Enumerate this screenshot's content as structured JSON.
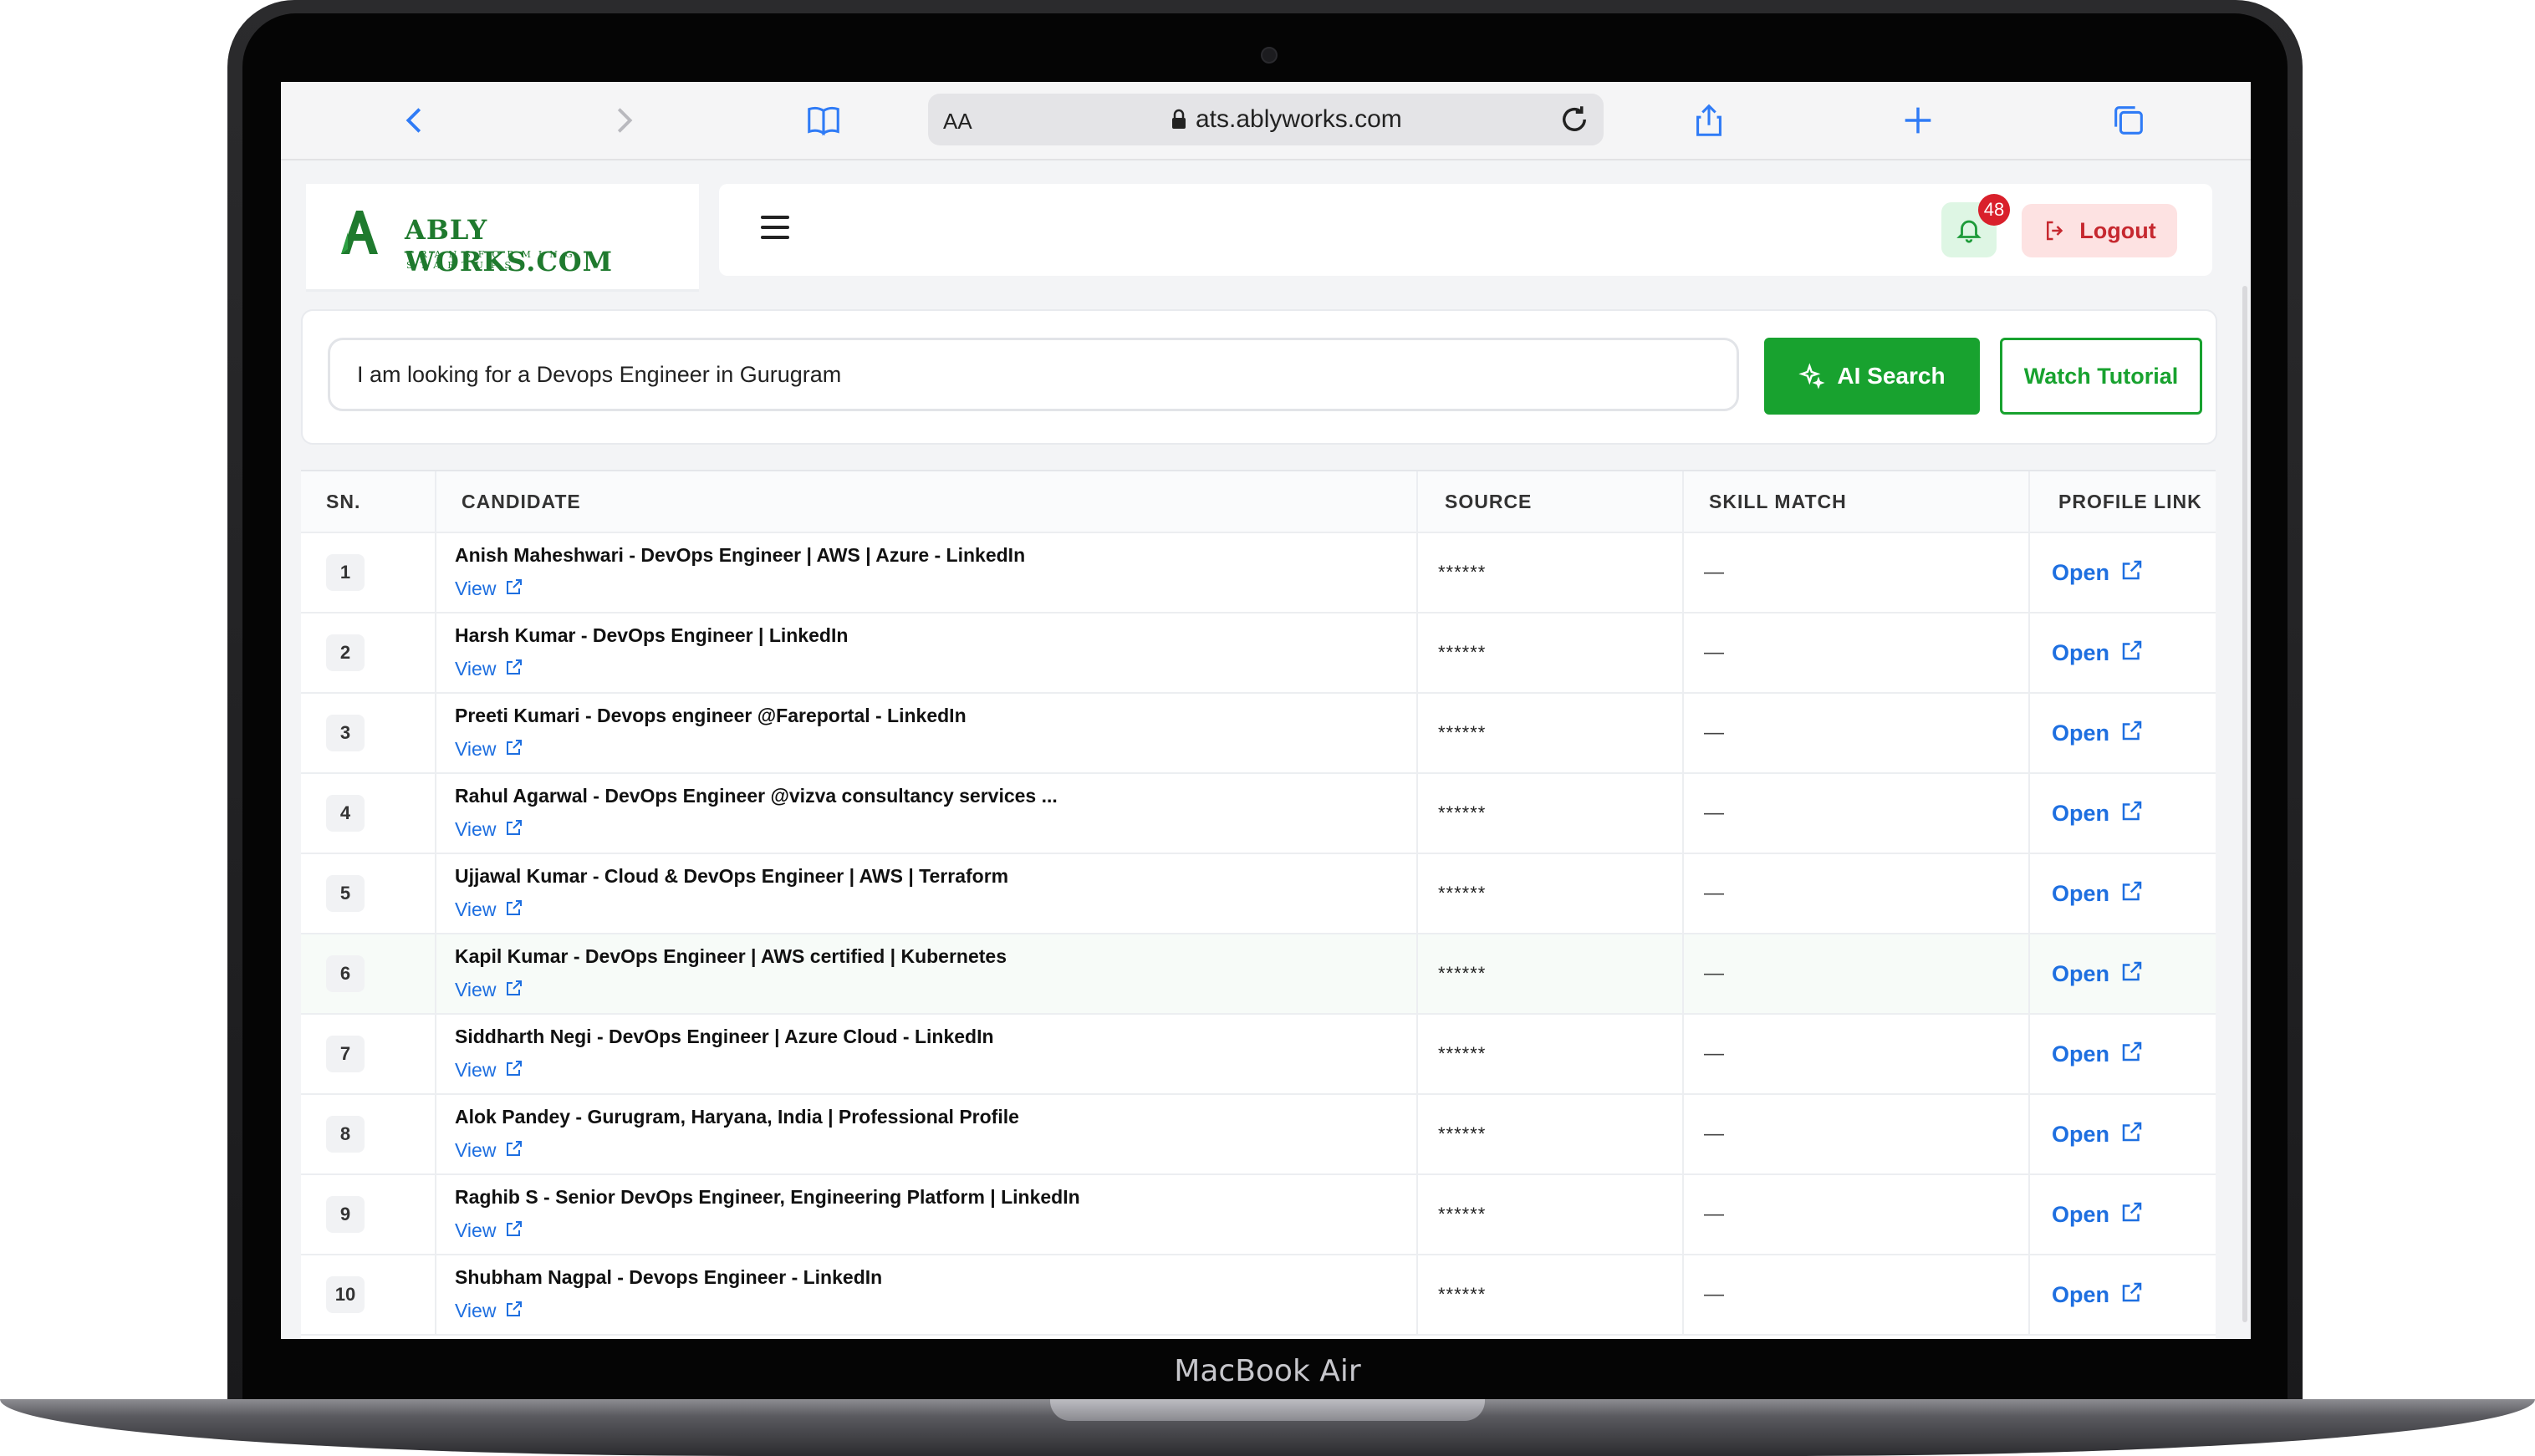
{
  "device": {
    "label": "MacBook Air"
  },
  "browser": {
    "aa_label": "AA",
    "url": "ats.ablyworks.com",
    "icons": [
      "back-icon",
      "forward-icon",
      "bookmarks-icon",
      "lock-icon",
      "reload-icon",
      "share-icon",
      "new-tab-icon",
      "tabs-icon"
    ],
    "accent": "#2f7bf6"
  },
  "brand": {
    "name": "ABLY WORKS.COM",
    "tagline": "TRANSFORMING STARTUPS",
    "color": "#1f7a2e"
  },
  "header": {
    "notification_count": "48",
    "logout_label": "Logout"
  },
  "search": {
    "value": "I am looking for a Devops Engineer in Gurugram",
    "ai_button_label": "AI Search",
    "tutorial_button_label": "Watch Tutorial",
    "accent": "#18a22f"
  },
  "table": {
    "headers": {
      "sn": "SN.",
      "candidate": "CANDIDATE",
      "source": "SOURCE",
      "skill_match": "SKILL MATCH",
      "profile_link": "PROFILE LINK"
    },
    "rows": [
      {
        "sn": "1",
        "name": "Anish Maheshwari - DevOps Engineer | AWS | Azure - LinkedIn",
        "view": "View",
        "source": "******",
        "skill": "—",
        "link": "Open"
      },
      {
        "sn": "2",
        "name": "Harsh Kumar - DevOps Engineer | LinkedIn",
        "view": "View",
        "source": "******",
        "skill": "—",
        "link": "Open"
      },
      {
        "sn": "3",
        "name": "Preeti Kumari - Devops engineer @Fareportal - LinkedIn",
        "view": "View",
        "source": "******",
        "skill": "—",
        "link": "Open"
      },
      {
        "sn": "4",
        "name": "Rahul Agarwal - DevOps Engineer @vizva consultancy services ...",
        "view": "View",
        "source": "******",
        "skill": "—",
        "link": "Open"
      },
      {
        "sn": "5",
        "name": "Ujjawal Kumar - Cloud & DevOps Engineer | AWS | Terraform",
        "view": "View",
        "source": "******",
        "skill": "—",
        "link": "Open"
      },
      {
        "sn": "6",
        "name": "Kapil Kumar - DevOps Engineer | AWS certified | Kubernetes",
        "view": "View",
        "source": "******",
        "skill": "—",
        "link": "Open"
      },
      {
        "sn": "7",
        "name": "Siddharth Negi - DevOps Engineer | Azure Cloud - LinkedIn",
        "view": "View",
        "source": "******",
        "skill": "—",
        "link": "Open"
      },
      {
        "sn": "8",
        "name": "Alok Pandey - Gurugram, Haryana, India | Professional Profile",
        "view": "View",
        "source": "******",
        "skill": "—",
        "link": "Open"
      },
      {
        "sn": "9",
        "name": "Raghib S - Senior DevOps Engineer, Engineering Platform | LinkedIn",
        "view": "View",
        "source": "******",
        "skill": "—",
        "link": "Open"
      },
      {
        "sn": "10",
        "name": "Shubham Nagpal - Devops Engineer - LinkedIn",
        "view": "View",
        "source": "******",
        "skill": "—",
        "link": "Open"
      }
    ],
    "link_color": "#1e6fe0"
  }
}
